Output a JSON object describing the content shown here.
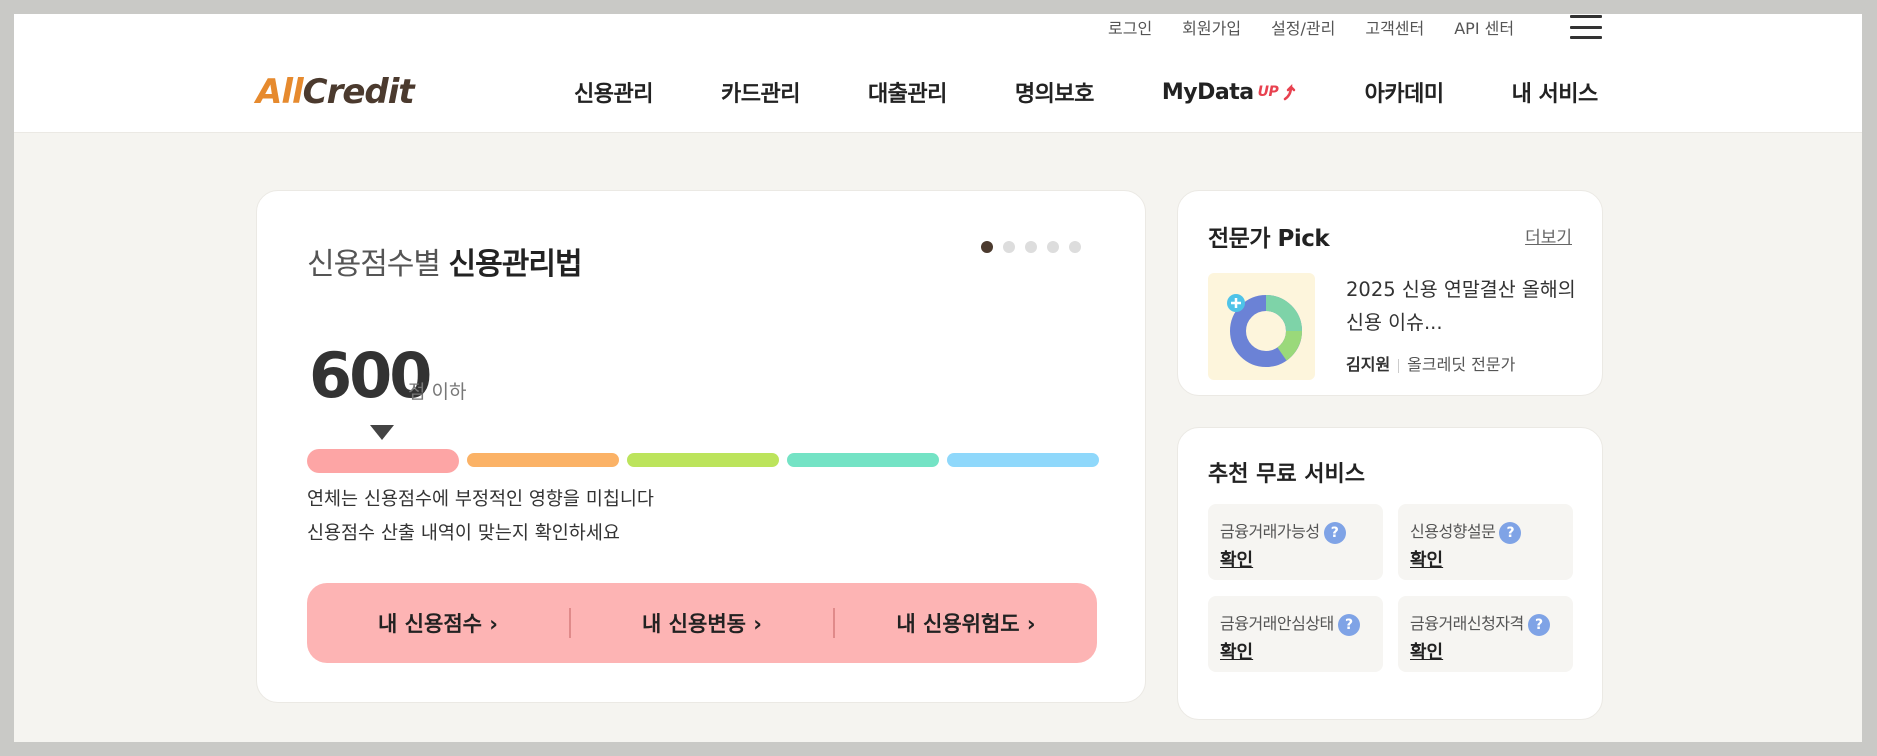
{
  "util_links": [
    "로그인",
    "회원가입",
    "설정/관리",
    "고객센터",
    "API 센터"
  ],
  "logo": {
    "all": "All",
    "credit": "Credit"
  },
  "nav": {
    "items": [
      "신용관리",
      "카드관리",
      "대출관리",
      "명의보호",
      "MyData",
      "아카데미",
      "내 서비스"
    ],
    "up_badge": "UP"
  },
  "main_card": {
    "title_light": "신용점수별 ",
    "title_bold": "신용관리법",
    "pagination": {
      "total": 5,
      "active": 1
    },
    "score": "600",
    "score_unit": "점 이하",
    "bar_colors": [
      "#fda5a5",
      "#fbb266",
      "#bce45c",
      "#74e3c5",
      "#8fd8fb"
    ],
    "desc_line1": "연체는 신용점수에 부정적인 영향을 미칩니다",
    "desc_line2": "신용점수 산출 내역이 맞는지 확인하세요",
    "buttons": [
      "내 신용점수 ›",
      "내 신용변동 ›",
      "내 신용위험도 ›"
    ]
  },
  "pick": {
    "title": "전문가 Pick",
    "more": "더보기",
    "headline": "2025 신용 연말결산 올해의 신용 이슈...",
    "author": "김지원",
    "role": "올크레딧 전문가"
  },
  "free": {
    "title": "추천 무료 서비스",
    "items": [
      {
        "label": "금융거래가능성",
        "action": "확인"
      },
      {
        "label": "신용성향설문",
        "action": "확인"
      },
      {
        "label": "금융거래안심상태",
        "action": "확인"
      },
      {
        "label": "금융거래신청자격",
        "action": "확인"
      }
    ]
  }
}
